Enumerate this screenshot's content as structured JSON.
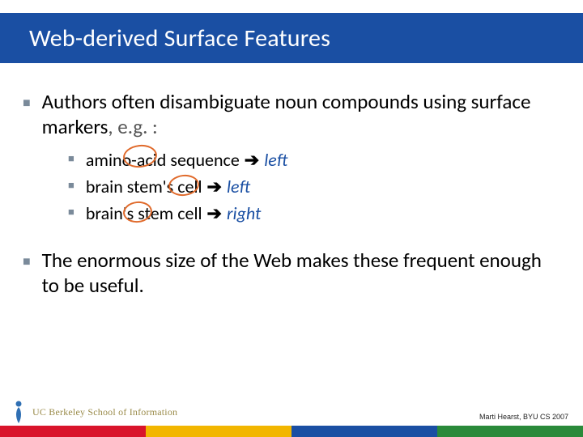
{
  "slide": {
    "title": "Web-derived Surface Features",
    "bullet1": "Authors often disambiguate noun compounds using surface markers",
    "eg_label": ", e.g. :",
    "subitems": [
      {
        "text": "amino-acid sequence",
        "direction": "left"
      },
      {
        "text": "brain stem's cell",
        "direction": "left"
      },
      {
        "text": "brain's stem cell",
        "direction": "right"
      }
    ],
    "bullet2": "The enormous size of the Web makes these frequent enough to be useful."
  },
  "footer": {
    "logo_text": "UC Berkeley School of Information",
    "credit": "Marti Hearst, BYU CS 2007"
  },
  "colors": {
    "title_bg": "#1a4fa3",
    "accent_blue": "#1a4fa3",
    "circle": "#e06a2b",
    "strip": [
      "#d9142b",
      "#f2b600",
      "#1a4fa3",
      "#2a8a3a"
    ]
  },
  "glyphs": {
    "square_bullet": "■",
    "arrow_right": "➔"
  }
}
